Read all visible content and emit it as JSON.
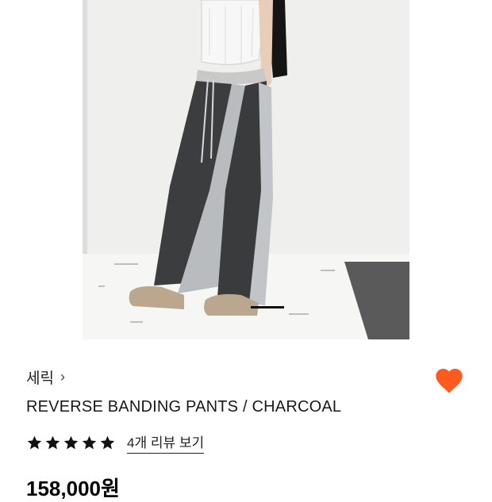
{
  "product": {
    "brand": "세릭",
    "brand_chevron": "›",
    "title": "REVERSE BANDING PANTS / CHARCOAL",
    "rating_stars": 5,
    "review_link": "4개 리뷰 보기",
    "price": "158,000원",
    "wishlist_active": true
  },
  "colors": {
    "heart": "#ff5a1f",
    "star": "#111111"
  },
  "icons": {
    "wishlist": "heart-icon",
    "rating": "star-icon",
    "brand_link": "chevron-right-icon"
  }
}
